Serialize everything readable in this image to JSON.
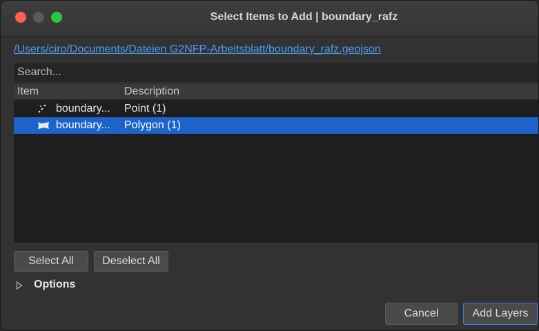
{
  "window": {
    "title": "Select Items to Add | boundary_rafz"
  },
  "file_path": "/Users/ciro/Documents/Dateien G2NFP-Arbeitsblatt/boundary_rafz.geojson",
  "search": {
    "placeholder": "Search..."
  },
  "table": {
    "columns": [
      "Item",
      "Description"
    ],
    "rows": [
      {
        "item": "boundary...",
        "description": "Point (1)",
        "icon": "point-layer-icon",
        "selected": false
      },
      {
        "item": "boundary...",
        "description": "Polygon (1)",
        "icon": "polygon-layer-icon",
        "selected": true
      }
    ]
  },
  "buttons": {
    "select_all": "Select All",
    "deselect_all": "Deselect All",
    "cancel": "Cancel",
    "add_layers": "Add Layers"
  },
  "options": {
    "label": "Options",
    "expanded": false
  },
  "colors": {
    "selection": "#1d63c9",
    "link": "#4d9bf3",
    "close": "#ff5f57",
    "maximize": "#28c840"
  }
}
